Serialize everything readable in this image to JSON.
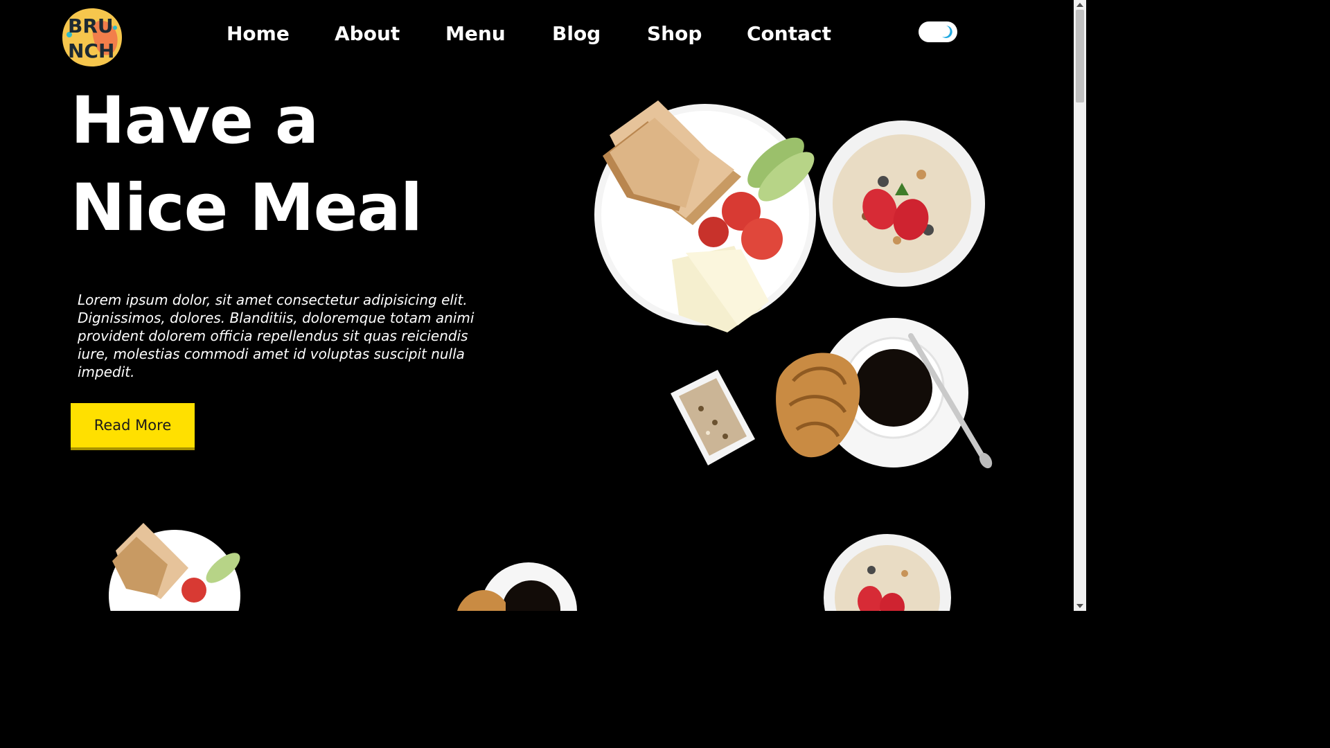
{
  "brand": {
    "logo_text_line1": "BRU",
    "logo_text_line2": "NCH",
    "accent": "#f6c64d",
    "accent2": "#f2764b"
  },
  "nav": {
    "items": [
      {
        "label": "Home"
      },
      {
        "label": "About"
      },
      {
        "label": "Menu"
      },
      {
        "label": "Blog"
      },
      {
        "label": "Shop"
      },
      {
        "label": "Contact"
      }
    ]
  },
  "theme_toggle": {
    "icon": "moon-icon",
    "state": "dark"
  },
  "hero": {
    "title_line1": "Have a",
    "title_line2": "Nice Meal",
    "description": "Lorem ipsum dolor, sit amet consectetur adipisicing elit. Dignissimos, dolores. Blanditiis, doloremque totam animi provident dolorem officia repellendus sit quas reiciendis iure, molestias commodi amet id voluptas suscipit nulla impedit.",
    "button_label": "Read More",
    "button_color": "#ffe000"
  },
  "images": {
    "plate_toast": "toast-plate-image",
    "bowl_muesli": "muesli-bowl-image",
    "coffee_croissant": "coffee-croissant-image",
    "granola_dish": "granola-dish-image"
  }
}
